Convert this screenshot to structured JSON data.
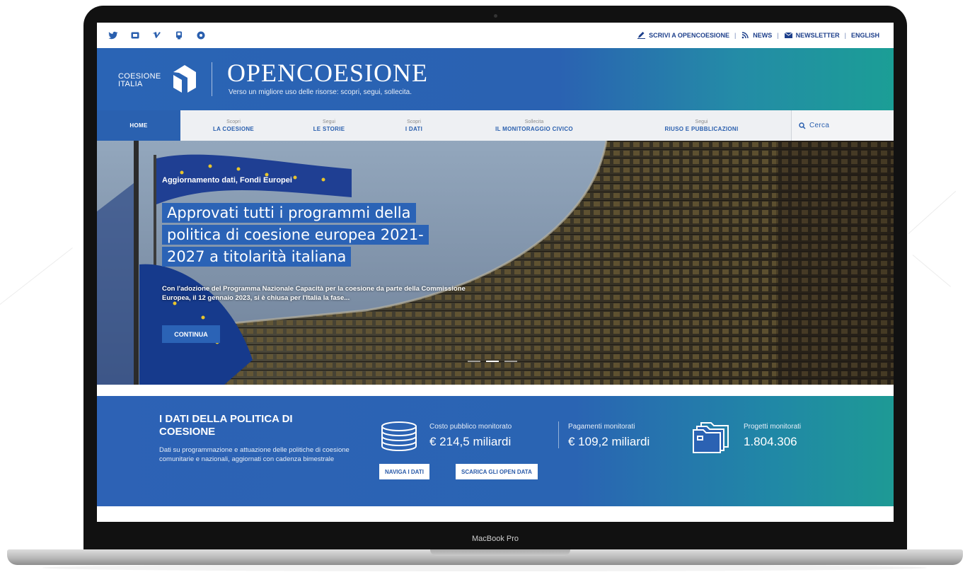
{
  "device": {
    "model_label": "MacBook Pro"
  },
  "topbar": {
    "social_icons": [
      "twitter-icon",
      "youtube-icon",
      "vimeo-icon",
      "flickr-icon",
      "other-social-icon"
    ],
    "links": [
      {
        "label": "SCRIVI A OPENCOESIONE",
        "icon": "pencil-icon"
      },
      {
        "label": "NEWS",
        "icon": "rss-icon"
      },
      {
        "label": "NEWSLETTER",
        "icon": "mail-icon"
      },
      {
        "label": "ENGLISH"
      }
    ],
    "separator": "|"
  },
  "header": {
    "logo_line1": "COESIONE",
    "logo_line2": "ITALIA",
    "title": "OPENCOESIONE",
    "subtitle": "Verso un migliore uso delle risorse: scopri, segui, sollecita."
  },
  "nav": {
    "home": "HOME",
    "items": [
      {
        "small": "Scopri",
        "label": "LA COESIONE"
      },
      {
        "small": "Segui",
        "label": "LE STORIE"
      },
      {
        "small": "Scopri",
        "label": "I DATI"
      },
      {
        "small": "Sollecita",
        "label": "IL MONITORAGGIO CIVICO"
      },
      {
        "small": "Segui",
        "label": "RIUSO E PUBBLICAZIONI"
      }
    ],
    "search_label": "Cerca"
  },
  "hero": {
    "kicker": "Aggiornamento dati, Fondi Europei",
    "title": "Approvati tutti i programmi della politica di coesione europea 2021-2027 a titolarità italiana",
    "text": "Con l'adozione del Programma Nazionale Capacità per la coesione da parte della Commissione Europea, il 12 gennaio 2023, si è chiusa per l'Italia la fase...",
    "cta": "CONTINUA",
    "slides": 3,
    "active_slide": 2
  },
  "stats": {
    "heading": "I DATI DELLA POLITICA DI COESIONE",
    "description": "Dati su programmazione e attuazione delle politiche di coesione comunitarie e nazionali, aggiornati con cadenza bimestrale",
    "items": [
      {
        "label": "Costo pubblico monitorato",
        "value": "€ 214,5 miliardi",
        "icon": "coins-icon"
      },
      {
        "label": "Pagamenti monitorati",
        "value": "€ 109,2 miliardi"
      },
      {
        "label": "Progetti monitorati",
        "value": "1.804.306",
        "icon": "folder-icon"
      }
    ],
    "buttons": [
      "NAVIGA I DATI",
      "SCARICA GLI OPEN DATA"
    ]
  },
  "colors": {
    "brand_blue": "#2a62b2",
    "teal": "#1b9e96",
    "nav_bg": "#eef0f3",
    "text_blue": "#1d3f8b"
  }
}
